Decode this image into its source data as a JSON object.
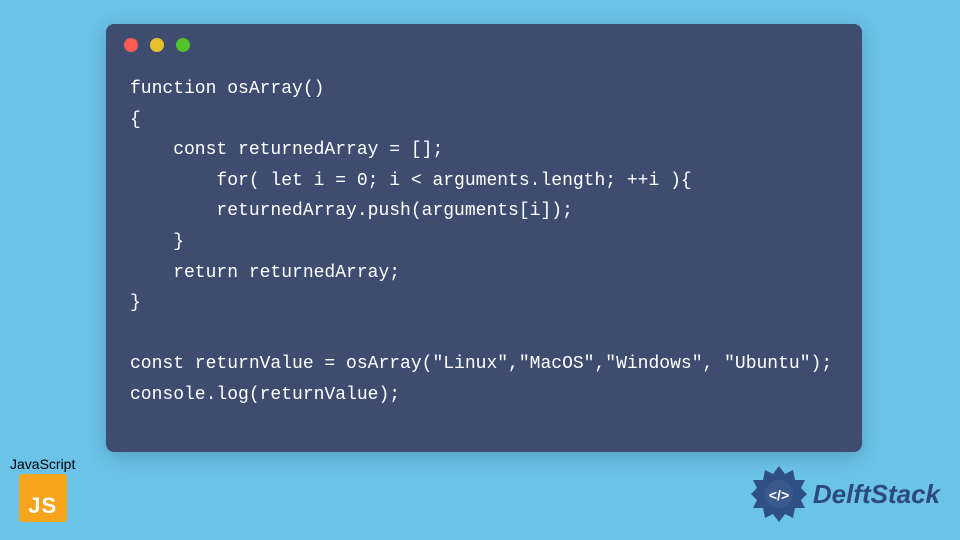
{
  "window": {
    "controls": [
      "red",
      "yellow",
      "green"
    ]
  },
  "code": {
    "lines": [
      "function osArray()",
      "{",
      "    const returnedArray = [];",
      "        for( let i = 0; i < arguments.length; ++i ){",
      "        returnedArray.push(arguments[i]);",
      "    }",
      "    return returnedArray;",
      "}",
      "",
      "const returnValue = osArray(\"Linux\",\"MacOS\",\"Windows\", \"Ubuntu\");",
      "console.log(returnValue);"
    ]
  },
  "js_badge": {
    "label": "JavaScript",
    "icon_text": "JS"
  },
  "delft": {
    "text": "DelftStack"
  },
  "colors": {
    "background": "#6bc3e8",
    "window": "#3e4d6f",
    "js_icon": "#f7a41d",
    "delft": "#2c4a7c"
  }
}
